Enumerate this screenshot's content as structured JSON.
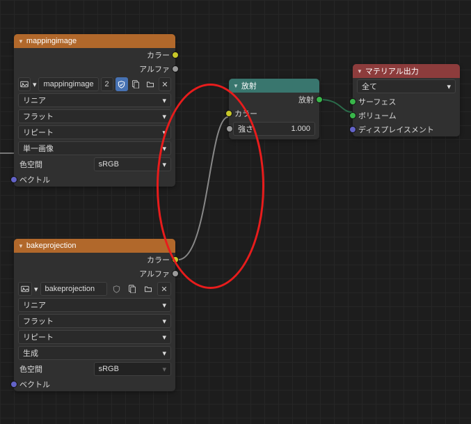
{
  "nodes": {
    "mappingimage": {
      "title": "mappingimage",
      "outputs": {
        "color": "カラー",
        "alpha": "アルファ"
      },
      "image_name": "mappingimage",
      "users": "2",
      "interpolation": "リニア",
      "projection": "フラット",
      "extension": "リピート",
      "source": "単一画像",
      "colorspace_label": "色空間",
      "colorspace_value": "sRGB",
      "vector_label": "ベクトル"
    },
    "bakeprojection": {
      "title": "bakeprojection",
      "outputs": {
        "color": "カラー",
        "alpha": "アルファ"
      },
      "image_name": "bakeprojection",
      "interpolation": "リニア",
      "projection": "フラット",
      "extension": "リピート",
      "source": "生成",
      "colorspace_label": "色空間",
      "colorspace_value": "sRGB",
      "vector_label": "ベクトル"
    },
    "emission": {
      "title": "放射",
      "output": "放射",
      "color_label": "カラー",
      "strength_label": "強さ",
      "strength_value": "1.000"
    },
    "material_output": {
      "title": "マテリアル出力",
      "target": "全て",
      "surface": "サーフェス",
      "volume": "ボリューム",
      "displacement": "ディスプレイスメント"
    }
  },
  "icons": {
    "image": "image-icon",
    "shield": "shield-icon",
    "copy": "copy-icon",
    "unlink": "unlink-icon",
    "close": "close-icon",
    "new": "new-icon",
    "open": "open-icon",
    "chevron_down": "▾"
  }
}
